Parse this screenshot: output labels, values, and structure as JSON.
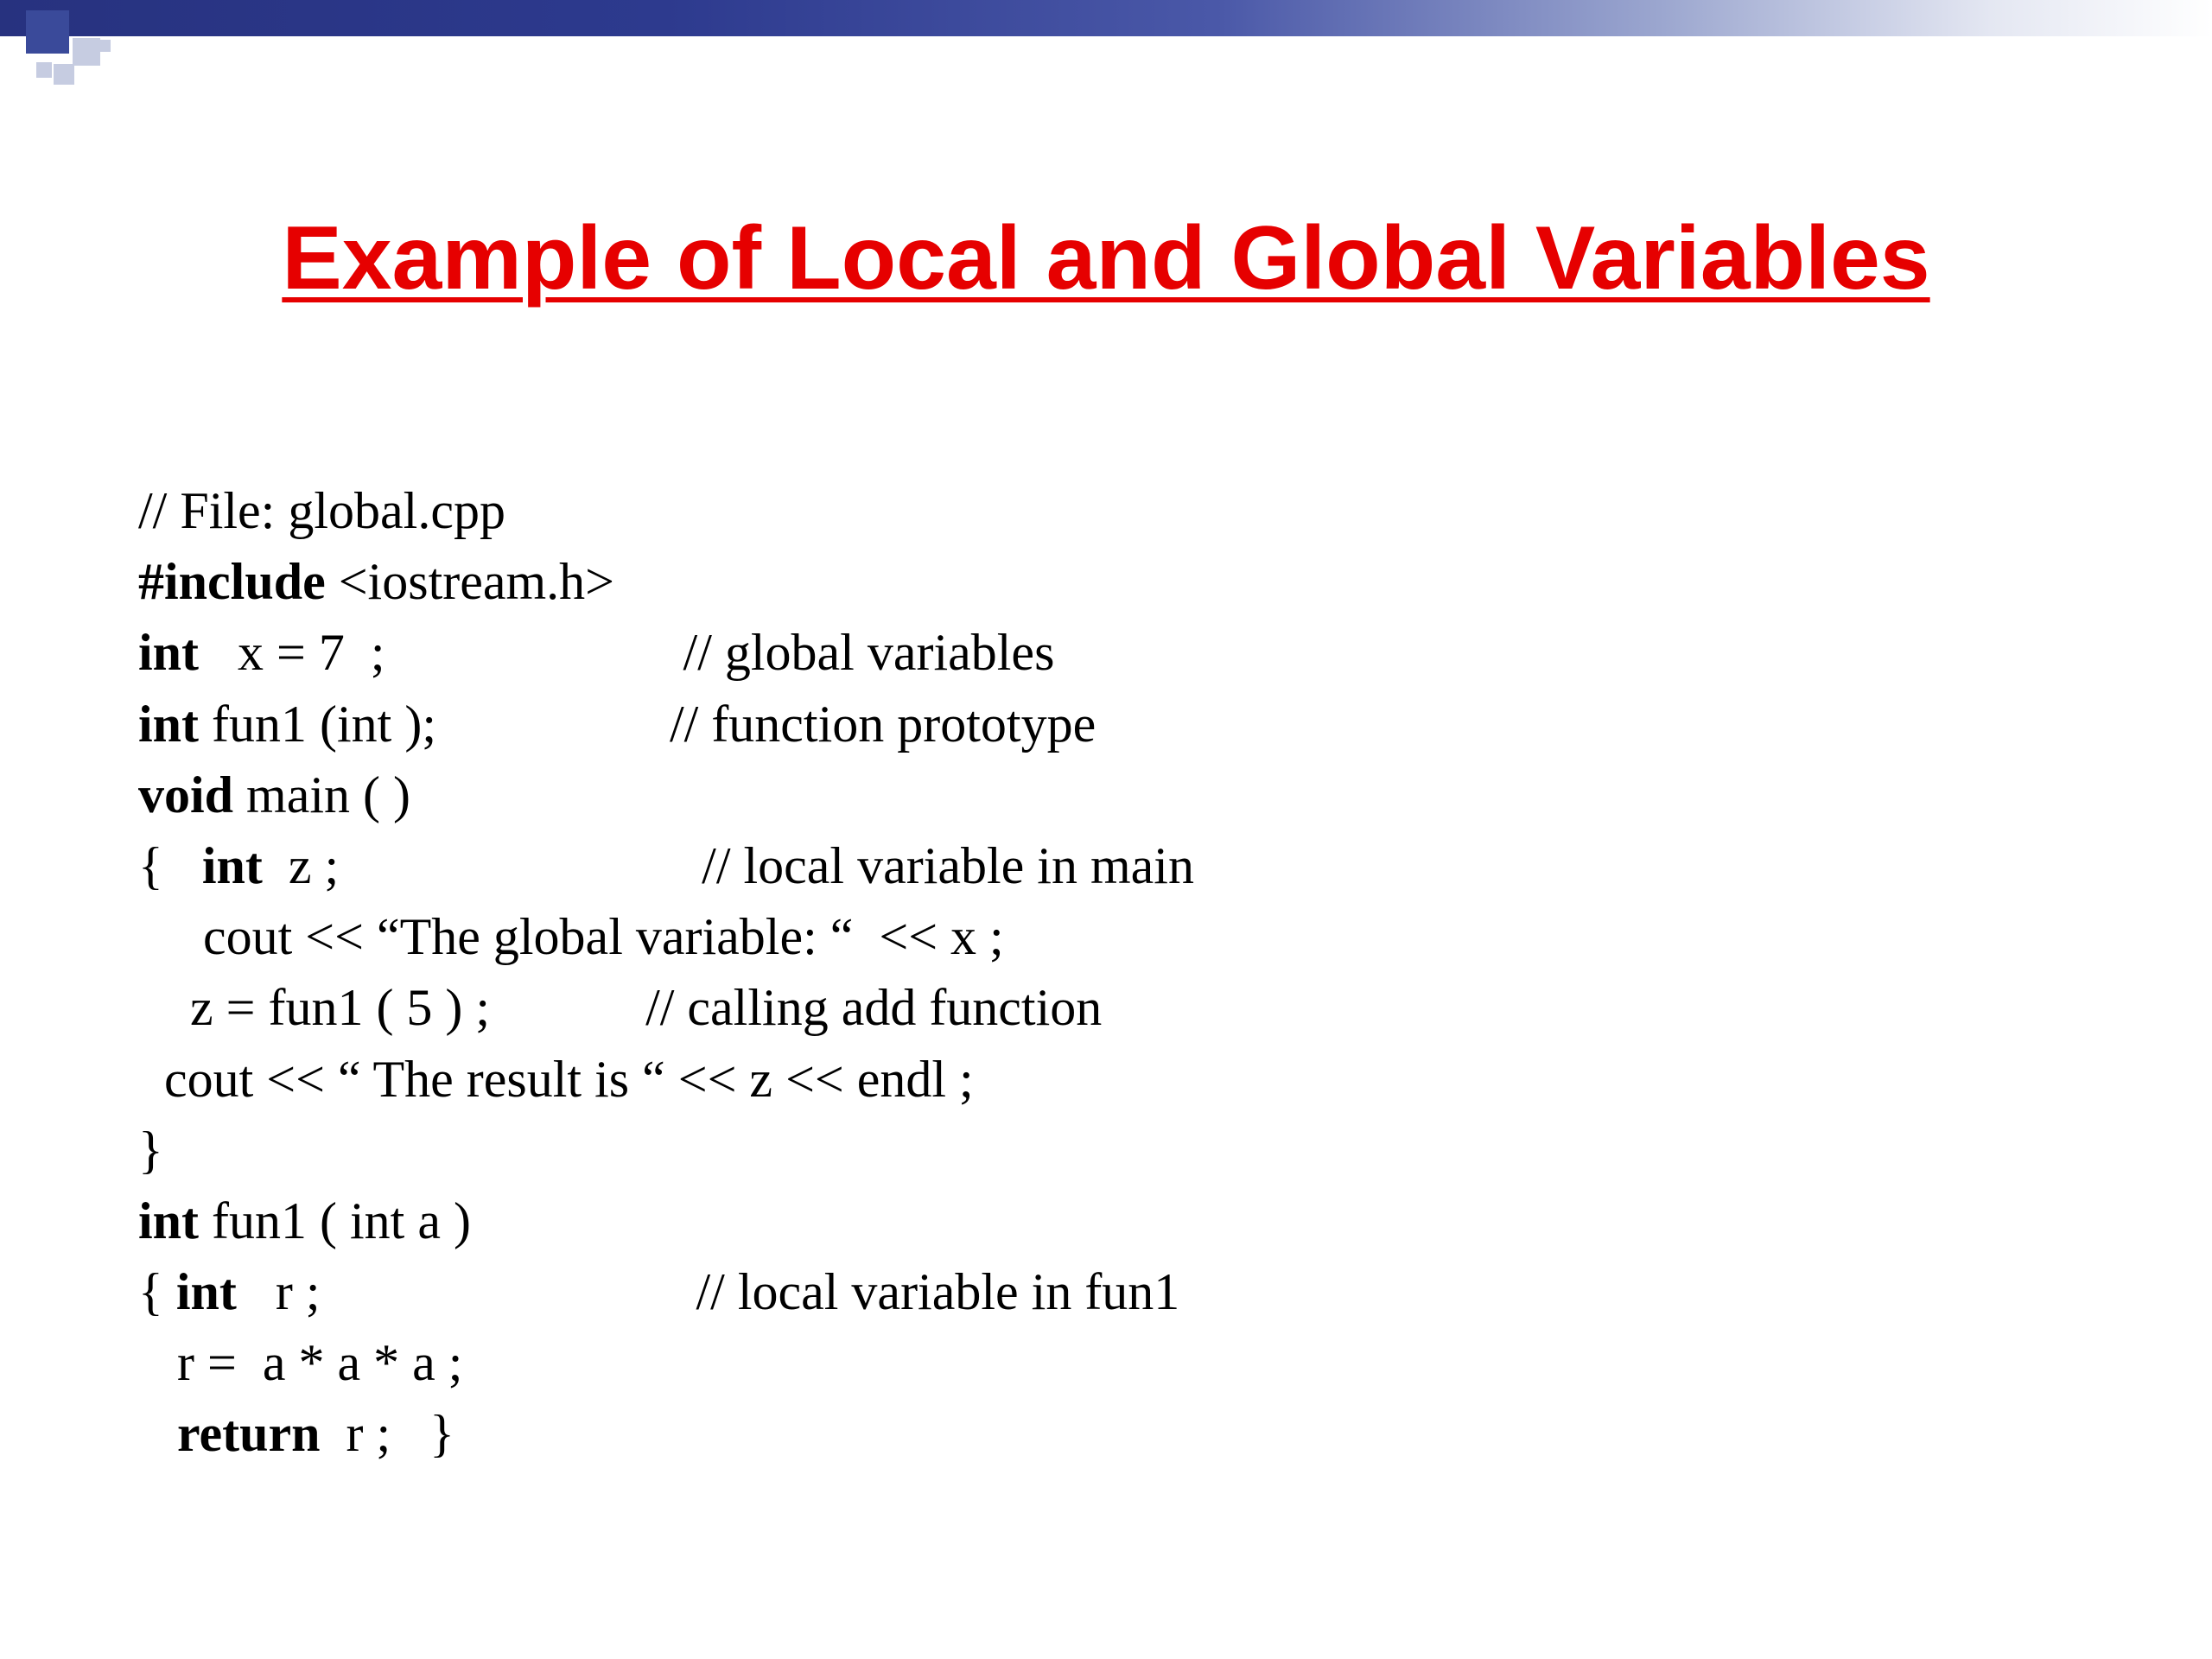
{
  "title": "Example of Local and Global Variables",
  "code": {
    "l1": "// File: global.cpp",
    "l2a": "#include",
    "l2b": " <iostream.h>",
    "l3a": "int",
    "l3b": "   x = 7  ;                       // global variables",
    "l4a": "int",
    "l4b": " fun1 (int );                  // function prototype",
    "l5a": "void",
    "l5b": " main ( )",
    "l6a": "{   ",
    "l6b": "int",
    "l6c": "  z ;                            // local variable in main",
    "l7": "     cout << “The global variable: “  << x ;",
    "l8": "    z = fun1 ( 5 ) ;            // calling add function",
    "l9": "  cout << “ The result is “ << z << endl ;",
    "l10": "}",
    "l11a": "int",
    "l11b": " fun1 ( int a )",
    "l12a": "{ ",
    "l12b": "int",
    "l12c": "   r ;                             // local variable in fun1",
    "l13": "   r =  a * a * a ;",
    "l14a": "   ",
    "l14b": "return",
    "l14c": "  r ;   }"
  }
}
